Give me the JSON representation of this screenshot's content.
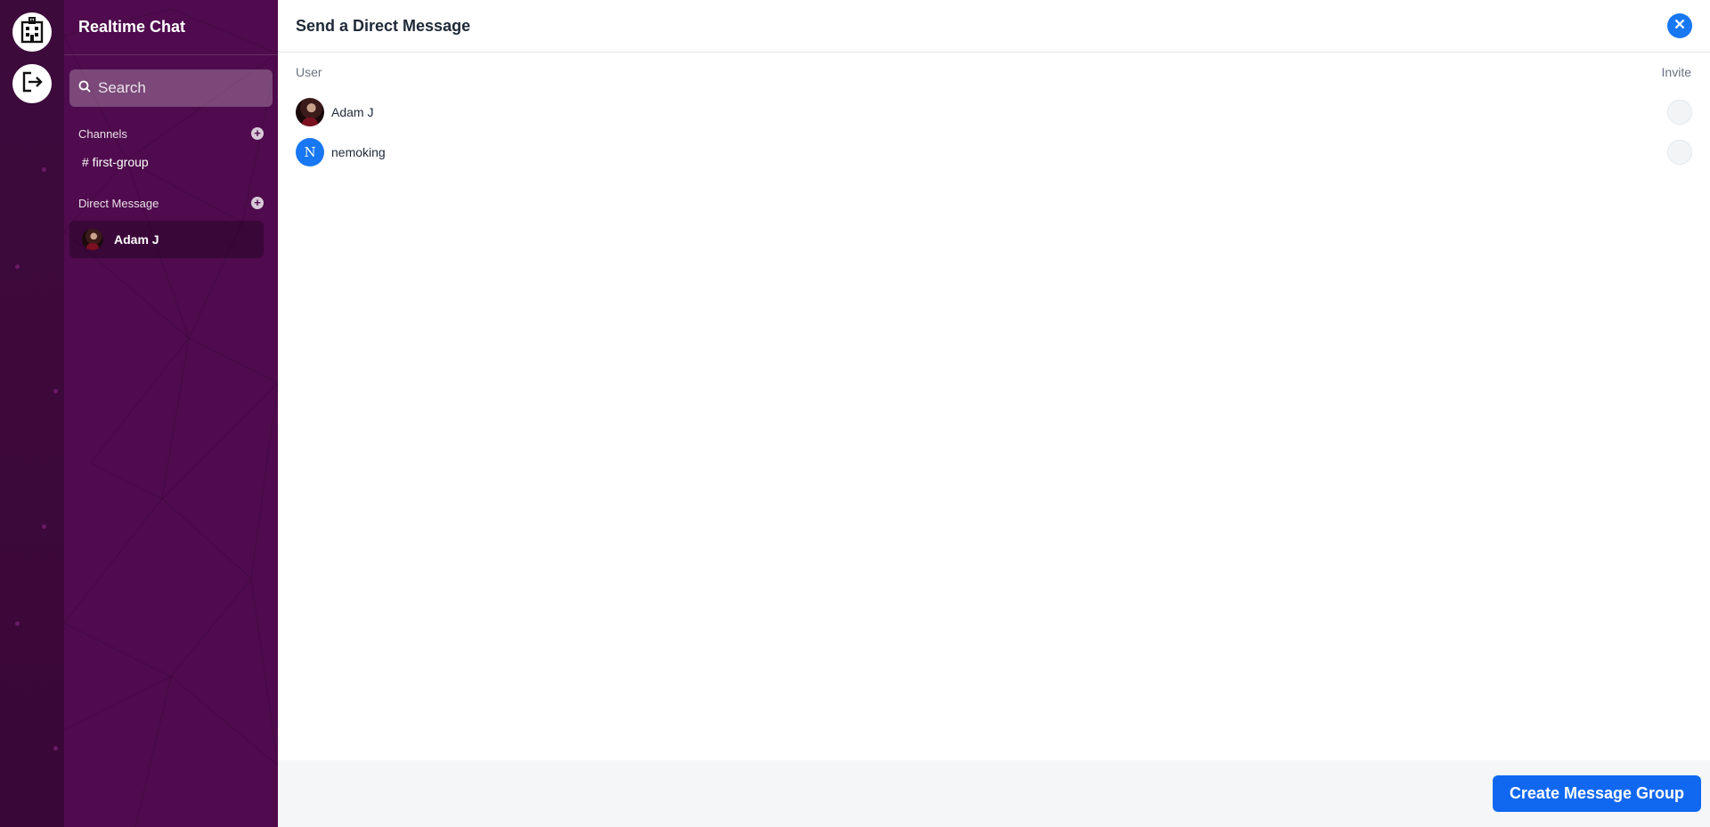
{
  "sidebar": {
    "title": "Realtime Chat",
    "search": {
      "placeholder": "Search",
      "value": ""
    },
    "channels_label": "Channels",
    "channels": [
      {
        "label": "# first-group"
      }
    ],
    "dm_label": "Direct Message",
    "dms": [
      {
        "name": "Adam J"
      }
    ]
  },
  "modal": {
    "title": "Send a Direct Message",
    "col_user": "User",
    "col_invite": "Invite",
    "users": [
      {
        "name": "Adam J",
        "avatar": "photo"
      },
      {
        "name": "nemoking",
        "avatar": "letter",
        "initial": "N"
      }
    ],
    "create_button": "Create Message Group"
  },
  "colors": {
    "sidebar_bg": "#4f0b4d",
    "rail_bg": "#3d0a3c",
    "accent": "#1877f2",
    "footer_bg": "#f5f6f8"
  },
  "icons": [
    "building-icon",
    "logout-icon",
    "search-icon",
    "plus-icon",
    "close-icon"
  ]
}
